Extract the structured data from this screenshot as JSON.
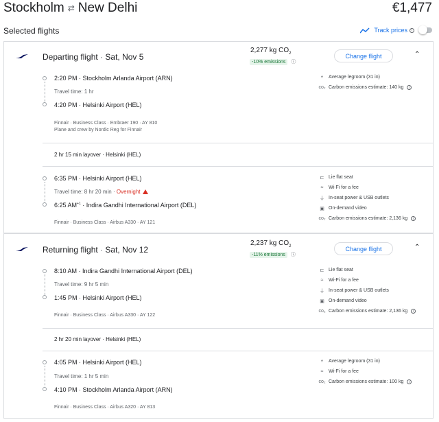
{
  "header": {
    "origin": "Stockholm",
    "destination": "New Delhi",
    "price": "€1,477"
  },
  "selected_label": "Selected flights",
  "track_prices": {
    "label": "Track prices",
    "enabled": false
  },
  "departing": {
    "title": "Departing flight",
    "date": "Sat, Nov 5",
    "co2_value": "2,277 kg CO",
    "co2_sub": "2",
    "emissions_badge": "-10% emissions",
    "change_label": "Change flight",
    "leg1": {
      "dep_time": "2:20 PM",
      "dep_airport": "Stockholm Arlanda Airport (ARN)",
      "travel_time": "Travel time: 1 hr",
      "arr_time": "4:20 PM",
      "arr_airport": "Helsinki Airport (HEL)",
      "details": "Finnair · Business Class · Embraer 190 · AY 810",
      "operated": "Plane and crew by Nordic Reg for Finnair",
      "amenities": [
        "Average legroom (31 in)",
        "Carbon emissions estimate: 140 kg"
      ]
    },
    "layover": "2 hr 15 min layover · Helsinki (HEL)",
    "leg2": {
      "dep_time": "6:35 PM",
      "dep_airport": "Helsinki Airport (HEL)",
      "travel_time": "Travel time: 8 hr 20 min",
      "overnight": "Overnight",
      "arr_time": "6:25 AM",
      "arr_sup": "+1",
      "arr_airport": "Indira Gandhi International Airport (DEL)",
      "details": "Finnair · Business Class · Airbus A330 · AY 121",
      "amenities": [
        "Lie flat seat",
        "Wi-Fi for a fee",
        "In-seat power & USB outlets",
        "On-demand video",
        "Carbon emissions estimate: 2,136 kg"
      ]
    }
  },
  "returning": {
    "title": "Returning flight",
    "date": "Sat, Nov 12",
    "co2_value": "2,237 kg CO",
    "co2_sub": "2",
    "emissions_badge": "-11% emissions",
    "change_label": "Change flight",
    "leg1": {
      "dep_time": "8:10 AM",
      "dep_airport": "Indira Gandhi International Airport (DEL)",
      "travel_time": "Travel time: 9 hr 5 min",
      "arr_time": "1:45 PM",
      "arr_airport": "Helsinki Airport (HEL)",
      "details": "Finnair · Business Class · Airbus A330 · AY 122",
      "amenities": [
        "Lie flat seat",
        "Wi-Fi for a fee",
        "In-seat power & USB outlets",
        "On-demand video",
        "Carbon emissions estimate: 2,136 kg"
      ]
    },
    "layover": "2 hr 20 min layover · Helsinki (HEL)",
    "leg2": {
      "dep_time": "4:05 PM",
      "dep_airport": "Helsinki Airport (HEL)",
      "travel_time": "Travel time: 1 hr 5 min",
      "arr_time": "4:10 PM",
      "arr_airport": "Stockholm Arlanda Airport (ARN)",
      "details": "Finnair · Business Class · Airbus A320 · AY 813",
      "amenities": [
        "Average legroom (31 in)",
        "Wi-Fi for a fee",
        "Carbon emissions estimate: 100 kg"
      ]
    }
  },
  "icons": {
    "airline": "finnair-logo-icon",
    "swap": "swap-arrows-icon",
    "trend": "trend-line-icon",
    "legroom": "seat-icon",
    "co2": "co2-icon",
    "wifi": "wifi-icon",
    "power": "power-plug-icon",
    "video": "video-icon",
    "flat": "lie-flat-seat-icon"
  },
  "colors": {
    "accent": "#1a73e8",
    "green": "#137333",
    "warning": "#d93025"
  }
}
